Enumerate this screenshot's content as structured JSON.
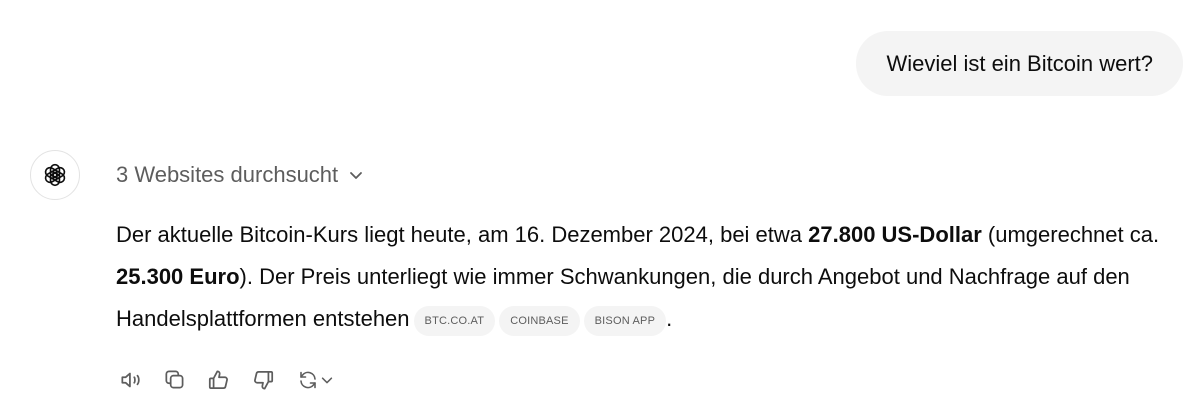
{
  "user_message": "Wieviel ist ein Bitcoin wert?",
  "assistant": {
    "search_summary": "3 Websites durchsucht",
    "answer": {
      "p1": "Der aktuelle Bitcoin-Kurs liegt heute, am 16. Dezember 2024, bei etwa ",
      "b1": "27.800 US-Dollar",
      "p2": " (umgerechnet ca. ",
      "b2": "25.300 Euro",
      "p3": "). Der Preis unterliegt wie immer Schwankungen, die durch Angebot und Nachfrage auf den Handelsplattformen entstehen",
      "end": "."
    },
    "sources": [
      "BTC.CO.AT",
      "COINBASE",
      "BISON APP"
    ]
  },
  "actions": {
    "icons": [
      "speaker-icon",
      "copy-icon",
      "thumbs-up-icon",
      "thumbs-down-icon",
      "regenerate-icon"
    ]
  },
  "colors": {
    "bubble_bg": "#f4f4f4",
    "muted_text": "#5d5d5d",
    "icon": "#5d5d5d"
  }
}
